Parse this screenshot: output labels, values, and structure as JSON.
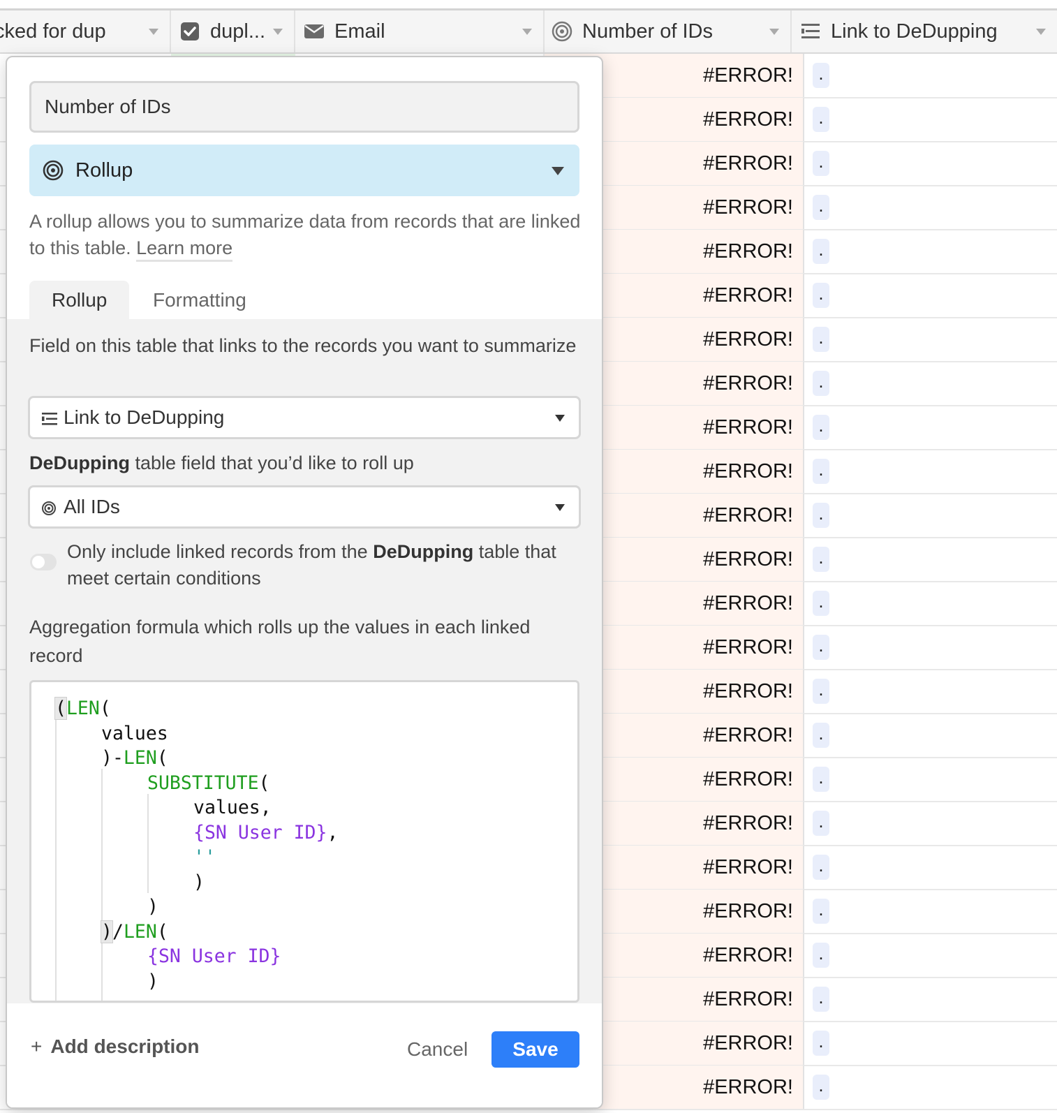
{
  "columns": [
    {
      "label": "cked for dup",
      "icon": "none"
    },
    {
      "label": "dupl...",
      "icon": "checkbox-icon"
    },
    {
      "label": "Email",
      "icon": "email-icon"
    },
    {
      "label": "Number of IDs",
      "icon": "rollup-icon"
    },
    {
      "label": "Link to DeDupping",
      "icon": "link-field-icon"
    }
  ],
  "rows": {
    "count": 24,
    "number_value": "#ERROR!",
    "link_value": "."
  },
  "dialog": {
    "field_name": "Number of IDs",
    "field_type": "Rollup",
    "description": "A rollup allows you to summarize data from records that are linked to this table.",
    "learn_more": "Learn more",
    "tabs": [
      "Rollup",
      "Formatting"
    ],
    "link_field_label": "Field on this table that links to the records you want to summarize",
    "link_field_value": "Link to DeDupping",
    "rollup_field_label_bold": "DeDupping",
    "rollup_field_label_rest": " table field that you’d like to roll up",
    "rollup_field_value": "All IDs",
    "condition_toggle": {
      "on": false,
      "label_start": "Only include linked records from the ",
      "label_bold": "DeDupping",
      "label_end": " table that meet certain conditions"
    },
    "formula_label": "Aggregation formula which rolls up the values in each linked record",
    "formula_lines": [
      {
        "indent": 0,
        "parts": [
          [
            "bracket",
            "("
          ],
          [
            "fn",
            "LEN"
          ],
          [
            "plain",
            "("
          ]
        ]
      },
      {
        "indent": 2,
        "parts": [
          [
            "plain",
            "values"
          ]
        ]
      },
      {
        "indent": 2,
        "parts": [
          [
            "plain",
            ")-"
          ],
          [
            "fn",
            "LEN"
          ],
          [
            "plain",
            "("
          ]
        ]
      },
      {
        "indent": 4,
        "parts": [
          [
            "fn",
            "SUBSTITUTE"
          ],
          [
            "plain",
            "("
          ]
        ]
      },
      {
        "indent": 6,
        "parts": [
          [
            "plain",
            "values,"
          ]
        ]
      },
      {
        "indent": 6,
        "parts": [
          [
            "fld",
            "{SN User ID}"
          ],
          [
            "plain",
            ","
          ]
        ]
      },
      {
        "indent": 6,
        "parts": [
          [
            "str",
            "''"
          ]
        ]
      },
      {
        "indent": 6,
        "parts": [
          [
            "plain",
            ")"
          ]
        ]
      },
      {
        "indent": 4,
        "parts": [
          [
            "plain",
            ")"
          ]
        ]
      },
      {
        "indent": 2,
        "parts": [
          [
            "bracket",
            ")"
          ],
          [
            "plain",
            "/"
          ],
          [
            "fn",
            "LEN"
          ],
          [
            "plain",
            "("
          ]
        ]
      },
      {
        "indent": 4,
        "parts": [
          [
            "fld",
            "{SN User ID}"
          ]
        ]
      },
      {
        "indent": 4,
        "parts": [
          [
            "plain",
            ")"
          ]
        ]
      }
    ],
    "add_description": "Add description",
    "cancel": "Cancel",
    "save": "Save"
  },
  "colors": {
    "accent": "#2d7ff9",
    "rollup_type_bg": "#d1ecf8",
    "error_cell_bg": "#fff4ef",
    "formula_function": "#1f9e1f",
    "formula_field": "#8a34e0"
  }
}
